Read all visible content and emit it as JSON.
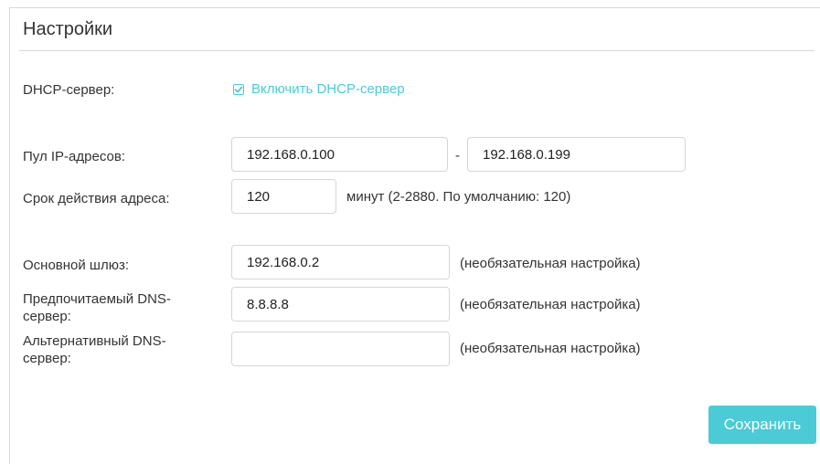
{
  "section": {
    "title": "Настройки"
  },
  "dhcp": {
    "label": "DHCP-сервер:",
    "checkbox_label": "Включить DHCP-сервер",
    "checked": true
  },
  "ip_pool": {
    "label": "Пул IP-адресов:",
    "start": "192.168.0.100",
    "separator": "-",
    "end": "192.168.0.199"
  },
  "lease": {
    "label": "Срок действия адреса:",
    "value": "120",
    "hint": "минут (2-2880. По умолчанию: 120)"
  },
  "gateway": {
    "label": "Основной шлюз:",
    "value": "192.168.0.2",
    "hint": "(необязательная настройка)"
  },
  "dns_primary": {
    "label_line1": "Предпочитаемый DNS-",
    "label_line2": "сервер:",
    "value": "8.8.8.8",
    "hint": "(необязательная настройка)"
  },
  "dns_alternate": {
    "label_line1": "Альтернативный DNS-",
    "label_line2": "сервер:",
    "value": "",
    "hint": "(необязательная настройка)"
  },
  "actions": {
    "save_label": "Сохранить"
  },
  "colors": {
    "accent": "#4acbd6",
    "border": "#d6d6d6",
    "text": "#333333"
  }
}
